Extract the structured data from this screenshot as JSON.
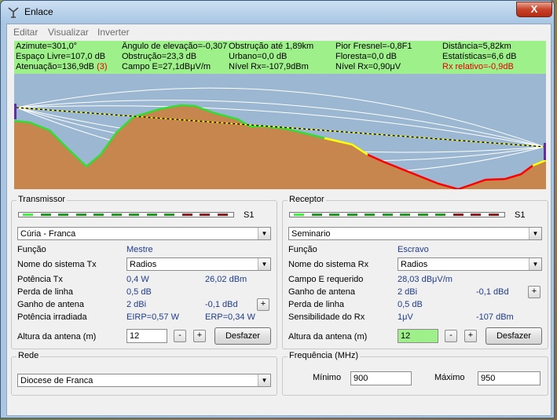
{
  "window": {
    "title": "Enlace",
    "close_label": "X",
    "icon": "antenna-icon"
  },
  "menu": [
    "Editar",
    "Visualizar",
    "Inverter"
  ],
  "info_rows": [
    [
      "Azimute=301,0°",
      "Ângulo de elevação=-0,307°",
      "Obstrução até 1,89km",
      "Pior Fresnel=-0,8F1",
      "Distância=5,82km"
    ],
    [
      "Espaço Livre=107,0 dB",
      "Obstrução=23,3 dB",
      "Urbano=0,0 dB",
      "Floresta=0,0 dB",
      "Estatísticas=6,6 dB"
    ],
    [
      "Atenuação=136,9dB",
      "Campo E=27,1dBμV/m",
      "Nível Rx=-107,9dBm",
      "Nível Rx=0,90μV",
      "Rx relativo=-0,9dB"
    ]
  ],
  "info_attenuation_note": "(3)",
  "colors": {
    "info_bg": "#9ef08a",
    "terrain": "#c8864f",
    "sky": "#9bb7d1",
    "los_ok": "#33dd33",
    "los_warn": "#ffff00",
    "los_bad": "#ff0000",
    "alert": "#e00000"
  },
  "transmitter": {
    "legend": "Transmissor",
    "meter_label": "S1",
    "meter_level": 0.75,
    "site": "Cúria - Franca",
    "function_label": "Função",
    "function_value": "Mestre",
    "system_label": "Nome do sistema Tx",
    "system_value": "Radios",
    "power_label": "Potência Tx",
    "power_w": "0,4 W",
    "power_dbm": "26,02 dBm",
    "line_loss_label": "Perda de linha",
    "line_loss_value": "0,5 dB",
    "gain_label": "Ganho de antena",
    "gain_dbi": "2 dBi",
    "gain_dbd": "-0,1 dBd",
    "radiated_label": "Potência irradiada",
    "eirp": "EIRP=0,57 W",
    "erp": "ERP=0,34 W",
    "height_label": "Altura da antena (m)",
    "height_value": "12",
    "undo_label": "Desfazer"
  },
  "receiver": {
    "legend": "Receptor",
    "meter_label": "S1",
    "meter_level": 0.75,
    "site": "Seminario",
    "function_label": "Função",
    "function_value": "Escravo",
    "system_label": "Nome do sistema Rx",
    "system_value": "Radios",
    "field_label": "Campo E requerido",
    "field_value": "28,03 dBμV/m",
    "gain_label": "Ganho de antena",
    "gain_dbi": "2 dBi",
    "gain_dbd": "-0,1 dBd",
    "line_loss_label": "Perda de linha",
    "line_loss_value": "0,5 dB",
    "sensitivity_label": "Sensibilidade do Rx",
    "sensitivity_uv": "1μV",
    "sensitivity_dbm": "-107 dBm",
    "height_label": "Altura da antena (m)",
    "height_value": "12",
    "undo_label": "Desfazer"
  },
  "network": {
    "legend": "Rede",
    "value": "Diocese de Franca"
  },
  "frequency": {
    "legend": "Frequência (MHz)",
    "min_label": "Mínimo",
    "min_value": "900",
    "max_label": "Máximo",
    "max_value": "950"
  },
  "stepper": {
    "minus": "-",
    "plus": "+"
  }
}
